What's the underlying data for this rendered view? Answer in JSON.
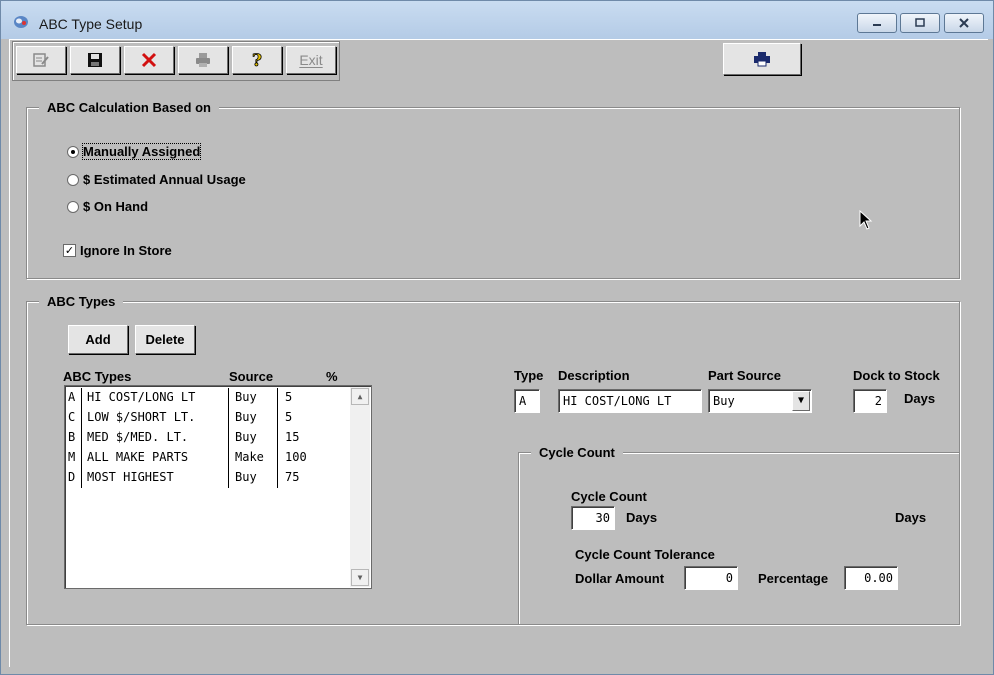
{
  "window": {
    "title": "ABC Type Setup"
  },
  "toolbar": {
    "buttons": [
      {
        "name": "edit",
        "icon": "edit-icon"
      },
      {
        "name": "save",
        "icon": "save-icon"
      },
      {
        "name": "delete",
        "icon": "delete-icon"
      },
      {
        "name": "print",
        "icon": "printer-icon"
      },
      {
        "name": "help",
        "icon": "help-icon"
      }
    ],
    "exit_label": "Exit",
    "report_icon": "printer-icon"
  },
  "calc_group": {
    "legend": "ABC Calculation Based on",
    "options": [
      {
        "label": "Manually Assigned",
        "selected": true
      },
      {
        "label": "$ Estimated Annual Usage",
        "selected": false
      },
      {
        "label": "$ On Hand",
        "selected": false
      }
    ],
    "ignore_in_store": {
      "label": "Ignore In Store",
      "checked": true
    }
  },
  "types_group": {
    "legend": "ABC Types",
    "add_label": "Add",
    "delete_label": "Delete",
    "list_headers": {
      "types": "ABC Types",
      "source": "Source",
      "percent": "%"
    },
    "rows": [
      {
        "code": "A",
        "description": "HI COST/LONG LT",
        "source": "Buy",
        "percent": "5"
      },
      {
        "code": "C",
        "description": "LOW $/SHORT LT.",
        "source": "Buy",
        "percent": "5"
      },
      {
        "code": "B",
        "description": "MED $/MED. LT.",
        "source": "Buy",
        "percent": "15"
      },
      {
        "code": "M",
        "description": "ALL MAKE PARTS",
        "source": "Make",
        "percent": "100"
      },
      {
        "code": "D",
        "description": "MOST HIGHEST",
        "source": "Buy",
        "percent": "75"
      }
    ]
  },
  "detail": {
    "type_label": "Type",
    "type_value": "A",
    "description_label": "Description",
    "description_value": "HI COST/LONG LT",
    "part_source_label": "Part Source",
    "part_source_value": "Buy",
    "dock_label": "Dock to Stock",
    "dock_value": "2",
    "dock_unit": "Days"
  },
  "cycle": {
    "legend": "Cycle Count",
    "count_label": "Cycle Count",
    "count_value": "30",
    "count_unit": "Days",
    "extra_days": "Days",
    "tolerance_label": "Cycle Count Tolerance",
    "dollar_label": "Dollar Amount",
    "dollar_value": "0",
    "percentage_label": "Percentage",
    "percentage_value": "0.00"
  }
}
